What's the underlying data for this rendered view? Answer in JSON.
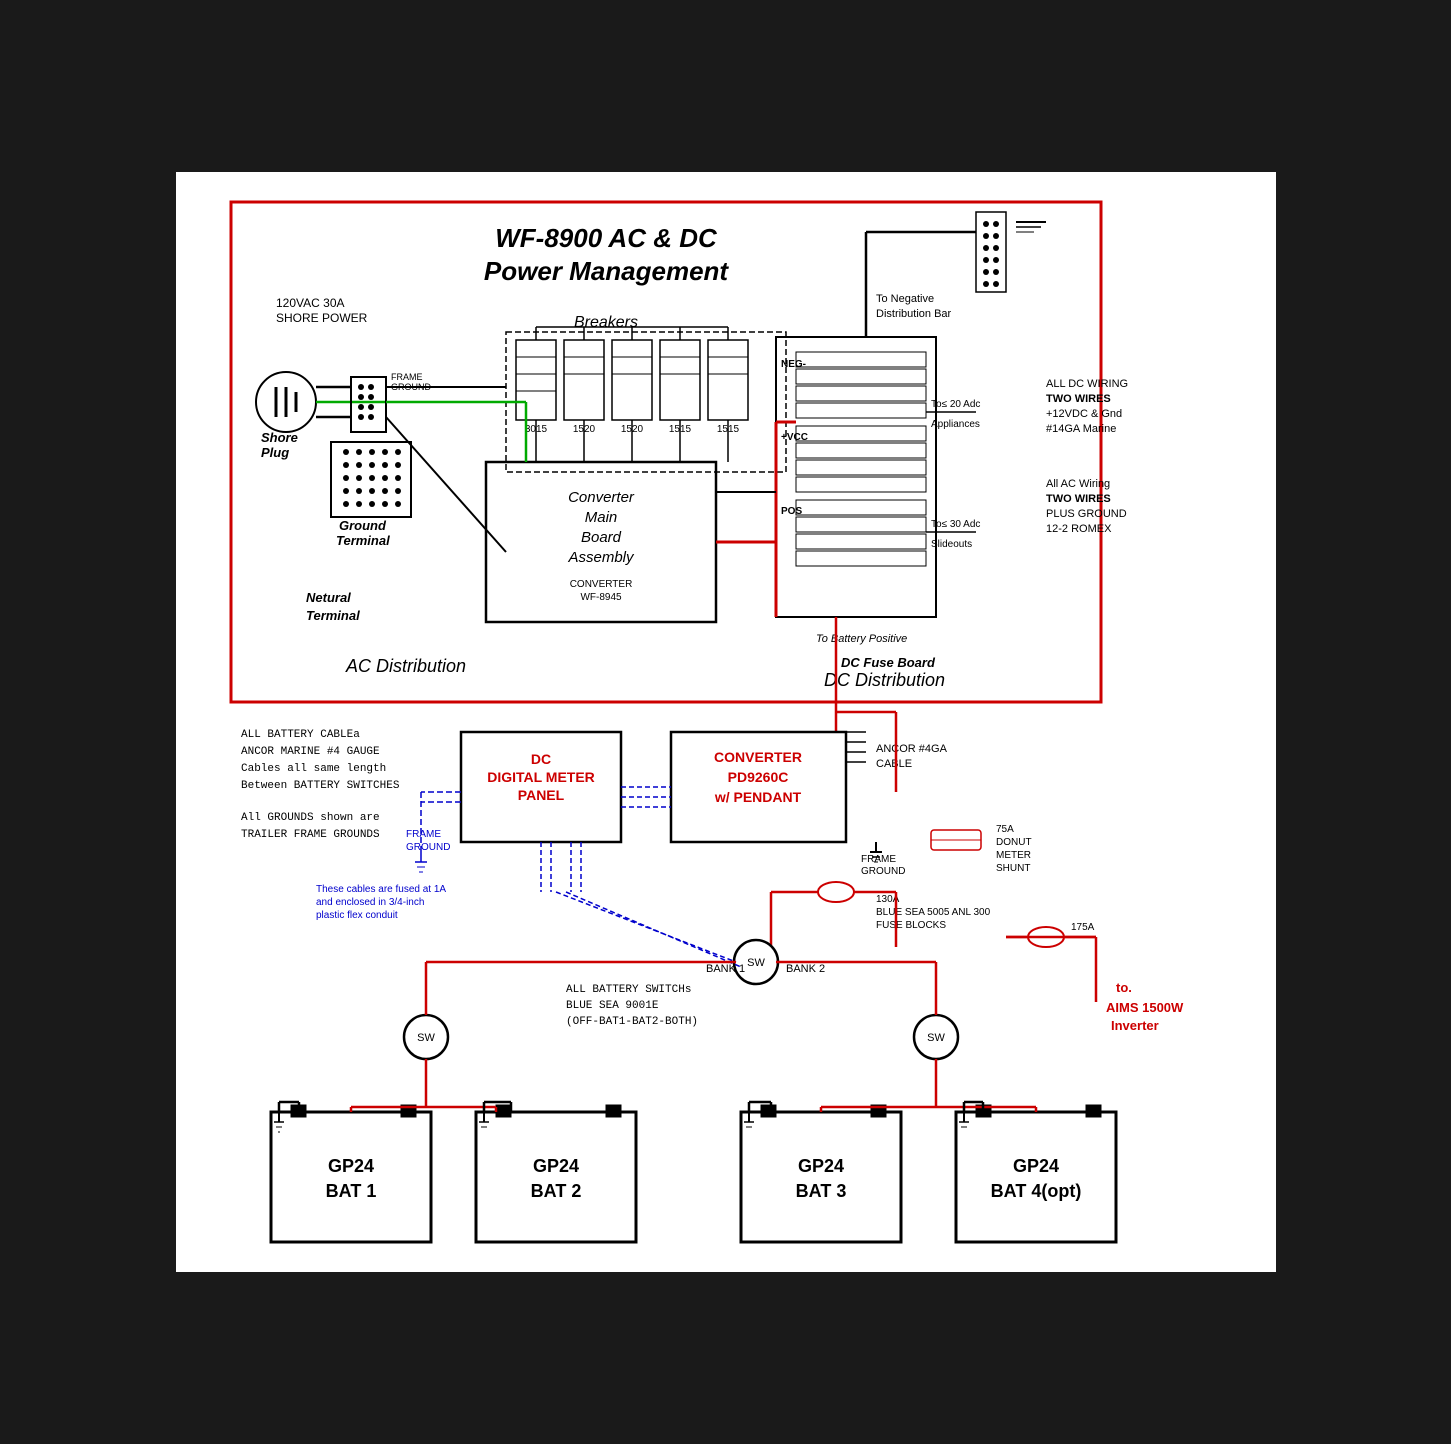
{
  "title": "WF-8900 AC & DC Power Management",
  "diagram": {
    "title_line1": "WF-8900 AC & DC",
    "title_line2": "Power Management",
    "shore_power_label": "120VAC 30A",
    "shore_power_label2": "SHORE POWER",
    "shore_plug_label": "Shore\nPlug",
    "frame_ground_label": "FRAME\nGROUND",
    "ground_terminal_label": "Ground\nTerminal",
    "neutral_terminal_label": "Netural\nTerminal",
    "breakers_label": "Breakers",
    "converter_label": "Converter\nMain\nBoard\nAssembly",
    "converter_sub": "CONVERTER\nWF-8945",
    "ac_distribution_label": "AC Distribution",
    "dc_distribution_label": "DC Distribution",
    "dc_fuse_board_label": "DC Fuse Board",
    "neg_label": "NEG-",
    "vcc_label": "+VCC",
    "pos_label": "POS",
    "to_neg_dist": "To Negative\nDistribution Bar",
    "to_20adc": "To≤ 20 Adc\nAppliances",
    "to_30adc": "To≤ 30 Adc\nSlideouts",
    "to_battery_pos": "To Battery Positive",
    "dc_wiring_note": "ALL DC WIRING\nTWO WIRES\n+12VDC & Gnd\n#14GA Marine",
    "ac_wiring_note": "All AC Wiring\nTWO WIRES\nPLUS GROUND\n12-2 ROMEX",
    "battery_cables_note": "ALL BATTERY CABLEa\nANCOR MARINE #4 GAUGE\nCables all same length\nBetween BATTERY SWITCHES",
    "grounds_note": "All GROUNDS shown are\nTRAILER FRAME GROUNDS",
    "dc_meter_panel": "DC\nDIGITAL METER\nPANEL",
    "converter_pendant": "CONVERTER\nPD9260C\nw/ PENDANT",
    "ancor_cable": "ANCOR #4GA\nCABLE",
    "frame_ground2": "FRAME\nGROUND",
    "donut_meter": "75A\nDONUT\nMETER\nSHUNT",
    "fuse_130a": "130A\nBLUE SEA 5005 ANL 300\nFUSE BLOCKS",
    "fuse_175a": "175A",
    "bank1": "BANK 1",
    "bank2": "BANK 2",
    "battery_switches": "ALL BATTERY SWITCHs\nBLUE SEA 9001E\n(OFF-BAT1-BAT2-BOTH)",
    "aims_label": "to.\nAIMS 1500W\nInverter",
    "frame_ground3": "FRAME\nGROUND",
    "cables_fused_note": "These cables are fused at 1A\nand enclosed in 3/4-inch\nplastic flex conduit",
    "bat1": "GP24\nBAT 1",
    "bat2": "GP24\nBAT 2",
    "bat3": "GP24\nBAT 3",
    "bat4": "GP24\nBAT 4(opt)",
    "breaker_vals": [
      "3015",
      "1520",
      "1520",
      "1515",
      "1515"
    ]
  }
}
